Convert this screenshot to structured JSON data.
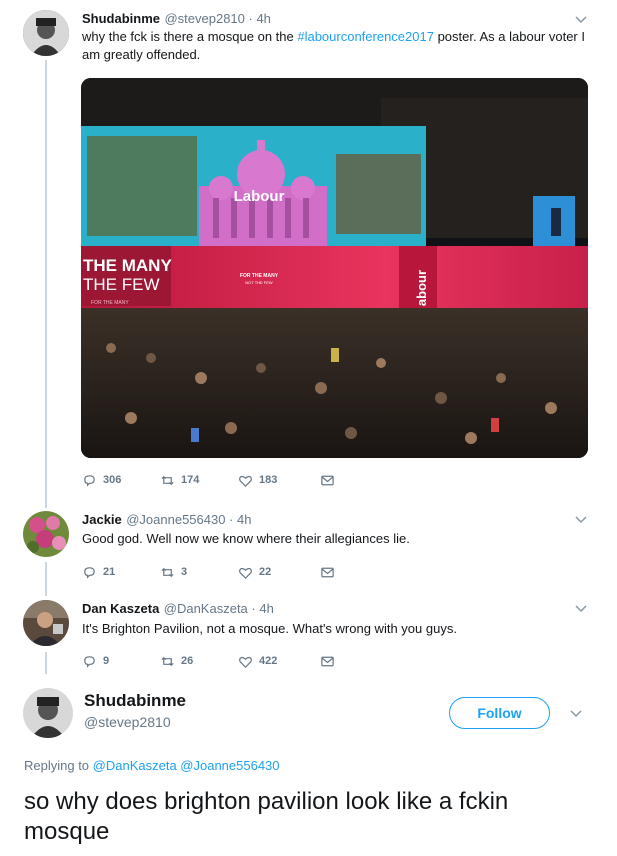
{
  "tweet1": {
    "name": "Shudabinme",
    "handle": "@stevep2810 · 4h",
    "text_before": "why the fck is there a mosque on the ",
    "hashtag": "#labourconference2017",
    "text_after": " poster. As a labour voter I am greatly offended.",
    "image_texts": {
      "screen_logo": "Labour",
      "banner_line1": "THE MANY",
      "banner_line2": "THE FEW",
      "banner_line3": "FOR THE MANY",
      "stage_text1": "FOR THE MANY",
      "stage_text2": "NOT THE FEW",
      "side_text": "abour"
    },
    "replies": "306",
    "retweets": "174",
    "likes": "183"
  },
  "tweet2": {
    "name": "Jackie",
    "handle": "@Joanne556430 · 4h",
    "text": "Good god. Well now we know where their allegiances lie.",
    "replies": "21",
    "retweets": "3",
    "likes": "22"
  },
  "tweet3": {
    "name": "Dan Kaszeta",
    "handle": "@DanKaszeta · 4h",
    "text": "It's Brighton Pavilion, not a mosque. What's wrong with you guys.",
    "replies": "9",
    "retweets": "26",
    "likes": "422"
  },
  "main_tweet": {
    "name": "Shudabinme",
    "handle": "@stevep2810",
    "follow_label": "Follow",
    "replying_prefix": "Replying to ",
    "replying_to": "@DanKaszeta @Joanne556430",
    "text": "so why does brighton pavilion look like a fckin mosque"
  },
  "colors": {
    "accent": "#1da1f2",
    "muted": "#657786",
    "thread": "#ccd6dd"
  }
}
